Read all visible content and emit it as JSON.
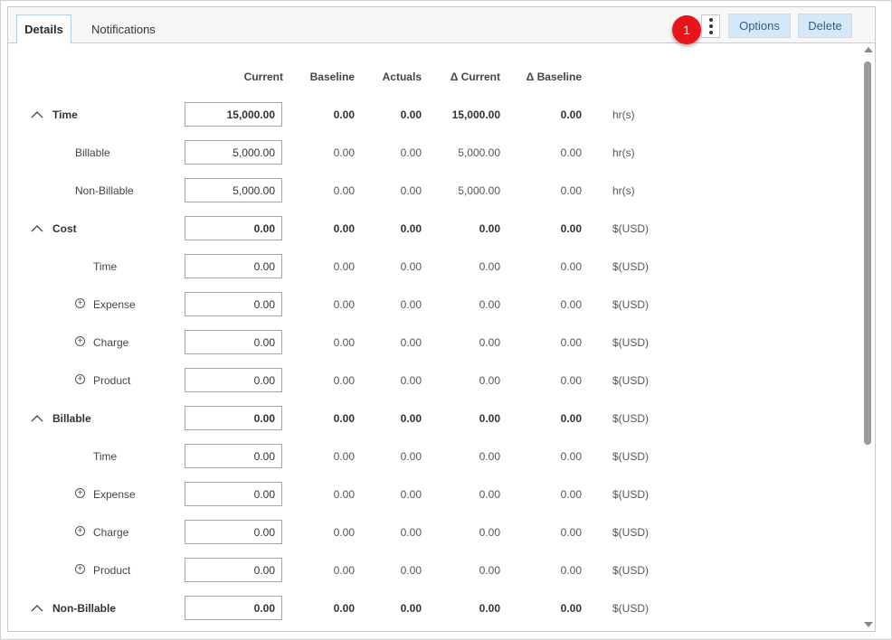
{
  "tabs": [
    {
      "label": "Details",
      "active": true
    },
    {
      "label": "Notifications",
      "active": false
    }
  ],
  "badge": "1",
  "buttons": {
    "options": "Options",
    "delete": "Delete"
  },
  "columns": {
    "current": "Current",
    "baseline": "Baseline",
    "actuals": "Actuals",
    "delta_current": "Δ Current",
    "delta_baseline": "Δ Baseline"
  },
  "rows": [
    {
      "label": "Time",
      "kind": "group",
      "current": "15,000.00",
      "baseline": "0.00",
      "actuals": "0.00",
      "delta_current": "15,000.00",
      "delta_baseline": "0.00",
      "unit": "hr(s)"
    },
    {
      "label": "Billable",
      "kind": "child",
      "current": "5,000.00",
      "baseline": "0.00",
      "actuals": "0.00",
      "delta_current": "5,000.00",
      "delta_baseline": "0.00",
      "unit": "hr(s)"
    },
    {
      "label": "Non-Billable",
      "kind": "child",
      "current": "5,000.00",
      "baseline": "0.00",
      "actuals": "0.00",
      "delta_current": "5,000.00",
      "delta_baseline": "0.00",
      "unit": "hr(s)"
    },
    {
      "label": "Cost",
      "kind": "group",
      "current": "0.00",
      "baseline": "0.00",
      "actuals": "0.00",
      "delta_current": "0.00",
      "delta_baseline": "0.00",
      "unit": "$(USD)"
    },
    {
      "label": "Time",
      "kind": "sub",
      "current": "0.00",
      "baseline": "0.00",
      "actuals": "0.00",
      "delta_current": "0.00",
      "delta_baseline": "0.00",
      "unit": "$(USD)"
    },
    {
      "label": "Expense",
      "kind": "expand",
      "current": "0.00",
      "baseline": "0.00",
      "actuals": "0.00",
      "delta_current": "0.00",
      "delta_baseline": "0.00",
      "unit": "$(USD)"
    },
    {
      "label": "Charge",
      "kind": "expand",
      "current": "0.00",
      "baseline": "0.00",
      "actuals": "0.00",
      "delta_current": "0.00",
      "delta_baseline": "0.00",
      "unit": "$(USD)"
    },
    {
      "label": "Product",
      "kind": "expand",
      "current": "0.00",
      "baseline": "0.00",
      "actuals": "0.00",
      "delta_current": "0.00",
      "delta_baseline": "0.00",
      "unit": "$(USD)"
    },
    {
      "label": "Billable",
      "kind": "group",
      "current": "0.00",
      "baseline": "0.00",
      "actuals": "0.00",
      "delta_current": "0.00",
      "delta_baseline": "0.00",
      "unit": "$(USD)"
    },
    {
      "label": "Time",
      "kind": "sub",
      "current": "0.00",
      "baseline": "0.00",
      "actuals": "0.00",
      "delta_current": "0.00",
      "delta_baseline": "0.00",
      "unit": "$(USD)"
    },
    {
      "label": "Expense",
      "kind": "expand",
      "current": "0.00",
      "baseline": "0.00",
      "actuals": "0.00",
      "delta_current": "0.00",
      "delta_baseline": "0.00",
      "unit": "$(USD)"
    },
    {
      "label": "Charge",
      "kind": "expand",
      "current": "0.00",
      "baseline": "0.00",
      "actuals": "0.00",
      "delta_current": "0.00",
      "delta_baseline": "0.00",
      "unit": "$(USD)"
    },
    {
      "label": "Product",
      "kind": "expand",
      "current": "0.00",
      "baseline": "0.00",
      "actuals": "0.00",
      "delta_current": "0.00",
      "delta_baseline": "0.00",
      "unit": "$(USD)"
    },
    {
      "label": "Non-Billable",
      "kind": "group",
      "current": "0.00",
      "baseline": "0.00",
      "actuals": "0.00",
      "delta_current": "0.00",
      "delta_baseline": "0.00",
      "unit": "$(USD)"
    }
  ],
  "colors": {
    "badge": "#e8141c",
    "button_bg": "#d6e8f7",
    "button_text": "#2e5f8a",
    "tab_border": "#b9cfe3"
  },
  "icons": {
    "collapse": "chevron-up-icon",
    "expand": "plus-circle-icon",
    "menu": "kebab-menu-icon"
  }
}
